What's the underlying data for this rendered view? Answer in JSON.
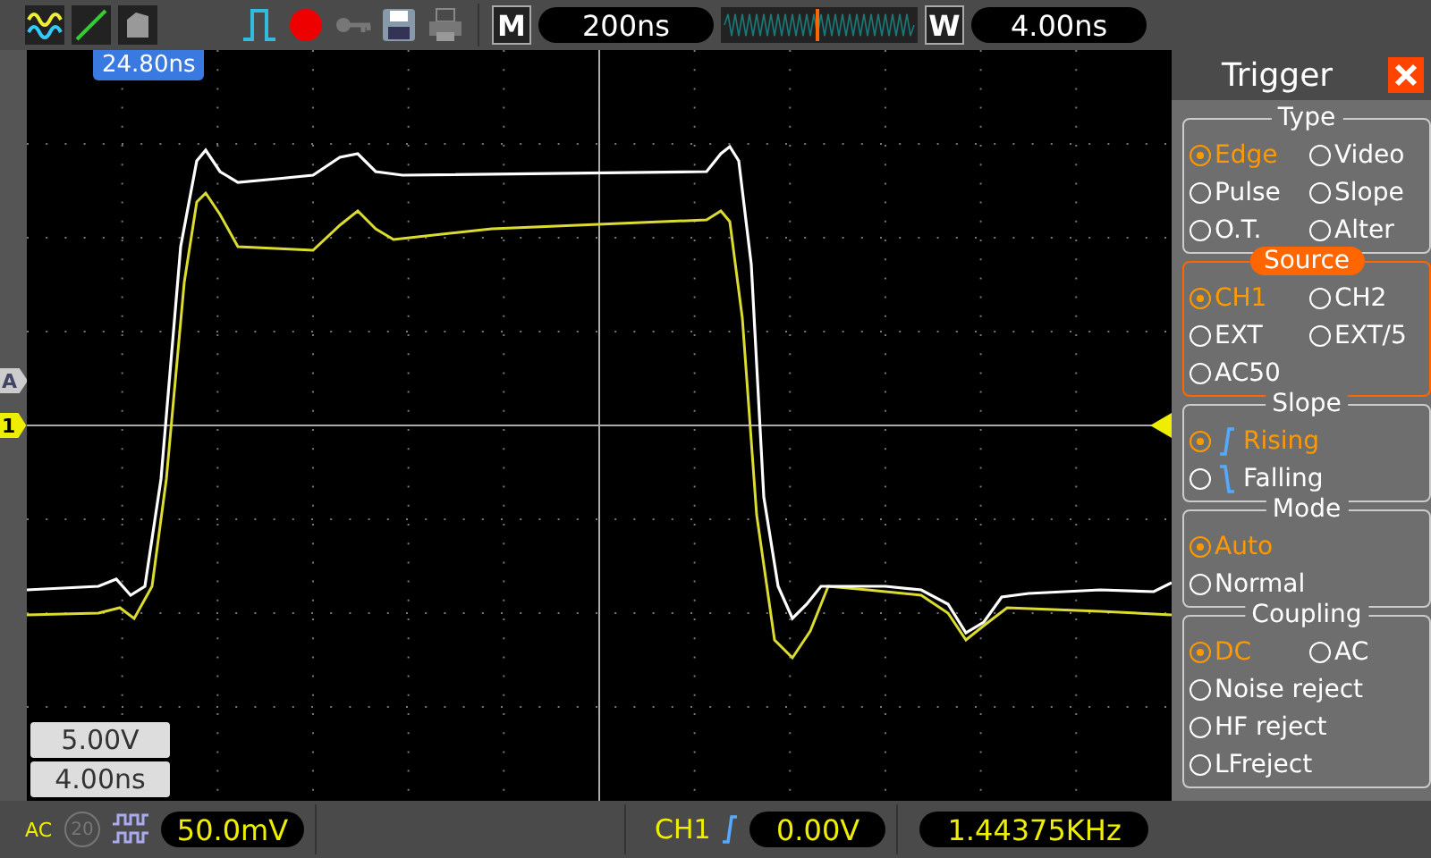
{
  "toolbar": {
    "memory_key": "M",
    "horizontal_position": "200ns",
    "window_key": "W",
    "window_scale": "4.00ns"
  },
  "trigger_position": "24.80ns",
  "channel_markers": [
    {
      "label": "A"
    },
    {
      "label": "1"
    }
  ],
  "scale_readouts": [
    "5.00V",
    "4.00ns"
  ],
  "status_bar": {
    "coupling": "AC",
    "bandwidth_limit": "20",
    "channel_scale": "50.0mV",
    "trigger_source": "CH1",
    "trigger_level": "0.00V",
    "frequency": "1.44375KHz"
  },
  "trigger_menu": {
    "title": "Trigger",
    "sections": [
      {
        "title": "Type",
        "highlighted": false,
        "rows": [
          [
            {
              "label": "Edge",
              "selected": true
            },
            {
              "label": "Video",
              "selected": false
            }
          ],
          [
            {
              "label": "Pulse",
              "selected": false
            },
            {
              "label": "Slope",
              "selected": false
            }
          ],
          [
            {
              "label": "O.T.",
              "selected": false
            },
            {
              "label": "Alter",
              "selected": false
            }
          ]
        ]
      },
      {
        "title": "Source",
        "highlighted": true,
        "rows": [
          [
            {
              "label": "CH1",
              "selected": true
            },
            {
              "label": "CH2",
              "selected": false
            }
          ],
          [
            {
              "label": "EXT",
              "selected": false
            },
            {
              "label": "EXT/5",
              "selected": false
            }
          ],
          [
            {
              "label": "AC50",
              "selected": false
            }
          ]
        ]
      },
      {
        "title": "Slope",
        "highlighted": false,
        "rows": [
          [
            {
              "label": "Rising",
              "selected": true,
              "kind": "rising"
            }
          ],
          [
            {
              "label": "Falling",
              "selected": false,
              "kind": "falling"
            }
          ]
        ]
      },
      {
        "title": "Mode",
        "highlighted": false,
        "rows": [
          [
            {
              "label": "Auto",
              "selected": true
            }
          ],
          [
            {
              "label": "Normal",
              "selected": false
            }
          ]
        ]
      },
      {
        "title": "Coupling",
        "highlighted": false,
        "rows": [
          [
            {
              "label": "DC",
              "selected": true
            },
            {
              "label": "AC",
              "selected": false
            }
          ],
          [
            {
              "label": "Noise reject",
              "selected": false
            }
          ],
          [
            {
              "label": "HF reject",
              "selected": false
            }
          ],
          [
            {
              "label": "LFreject",
              "selected": false
            }
          ]
        ]
      }
    ]
  }
}
